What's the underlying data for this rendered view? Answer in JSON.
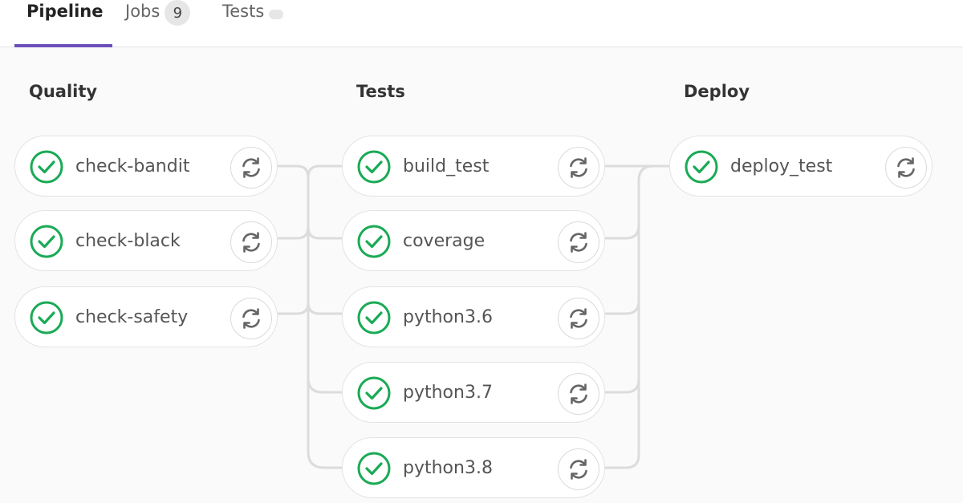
{
  "tabs": [
    {
      "label": "Pipeline"
    },
    {
      "label": "Jobs",
      "badge": "9"
    },
    {
      "label": "Tests"
    }
  ],
  "stages": [
    {
      "title": "Quality",
      "jobs": [
        "check-bandit",
        "check-black",
        "check-safety"
      ]
    },
    {
      "title": "Tests",
      "jobs": [
        "build_test",
        "coverage",
        "python3.6",
        "python3.7",
        "python3.8"
      ]
    },
    {
      "title": "Deploy",
      "jobs": [
        "deploy_test"
      ]
    }
  ],
  "colors": {
    "success": "#1aaa55",
    "accent": "#6b4fbb",
    "connector": "#dcdcdc"
  },
  "icons": {
    "status": "check-circle-icon",
    "retry": "retry-icon"
  }
}
